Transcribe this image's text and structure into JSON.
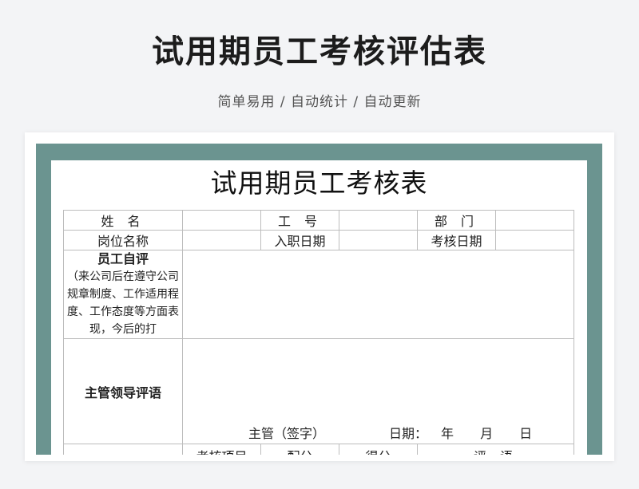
{
  "header": {
    "title": "试用期员工考核评估表",
    "subtitle": "简单易用 / 自动统计 / 自动更新"
  },
  "form": {
    "title": "试用期员工考核表",
    "labels": {
      "name": "姓 名",
      "employee_id": "工 号",
      "department": "部 门",
      "position": "岗位名称",
      "hire_date": "入职日期",
      "review_date": "考核日期",
      "self_review_title": "员工自评",
      "self_review_note": "（来公司后在遵守公司规章制度、工作适用程度、工作态度等方面表现，今后的打",
      "supervisor_review": "主管领导评语",
      "supervisor_sign": "主管（签字）",
      "date_label": "日期：",
      "date_parts": "年 月 日",
      "item": "考核项目",
      "points": "配分",
      "score": "得分",
      "comment": "评 语"
    },
    "values": {
      "name": "",
      "employee_id": "",
      "department": "",
      "position": "",
      "hire_date": "",
      "review_date": ""
    }
  }
}
